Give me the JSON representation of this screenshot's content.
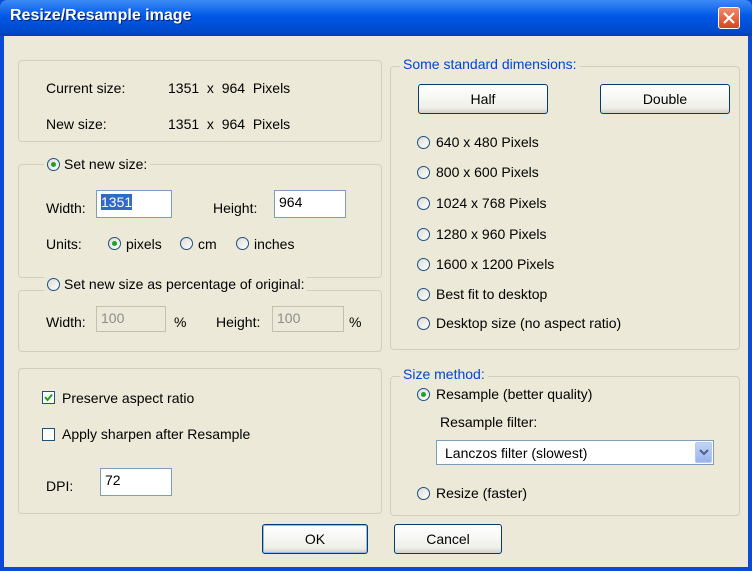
{
  "window": {
    "title": "Resize/Resample image"
  },
  "info": {
    "current_label": "Current size:",
    "current_value": "1351  x  964  Pixels",
    "new_label": "New size:",
    "new_value": "1351  x  964  Pixels"
  },
  "set_new_size": {
    "label": "Set new size:",
    "width_label": "Width:",
    "width_value": "1351",
    "height_label": "Height:",
    "height_value": "964",
    "units_label": "Units:",
    "units": [
      "pixels",
      "cm",
      "inches"
    ]
  },
  "percentage": {
    "label": "Set new size as percentage of original:",
    "width_label": "Width:",
    "width_value": "100",
    "height_label": "Height:",
    "height_value": "100",
    "unit": "%"
  },
  "options": {
    "preserve": "Preserve aspect ratio",
    "sharpen": "Apply sharpen after Resample",
    "dpi_label": "DPI:",
    "dpi_value": "72"
  },
  "standard": {
    "legend": "Some standard dimensions:",
    "half": "Half",
    "double": "Double",
    "items": [
      "640 x 480 Pixels",
      "800 x 600 Pixels",
      "1024 x 768 Pixels",
      "1280 x 960 Pixels",
      "1600 x 1200 Pixels",
      "Best fit to desktop",
      "Desktop size (no aspect ratio)"
    ]
  },
  "method": {
    "legend": "Size method:",
    "resample": "Resample (better quality)",
    "filter_label": "Resample filter:",
    "filter_value": "Lanczos filter (slowest)",
    "resize": "Resize (faster)"
  },
  "footer": {
    "ok": "OK",
    "cancel": "Cancel"
  },
  "colors": {
    "title_bar": "#0058e6",
    "dialog_bg": "#ece9d8",
    "group_label": "#0046d5",
    "selection": "#316ac5"
  }
}
